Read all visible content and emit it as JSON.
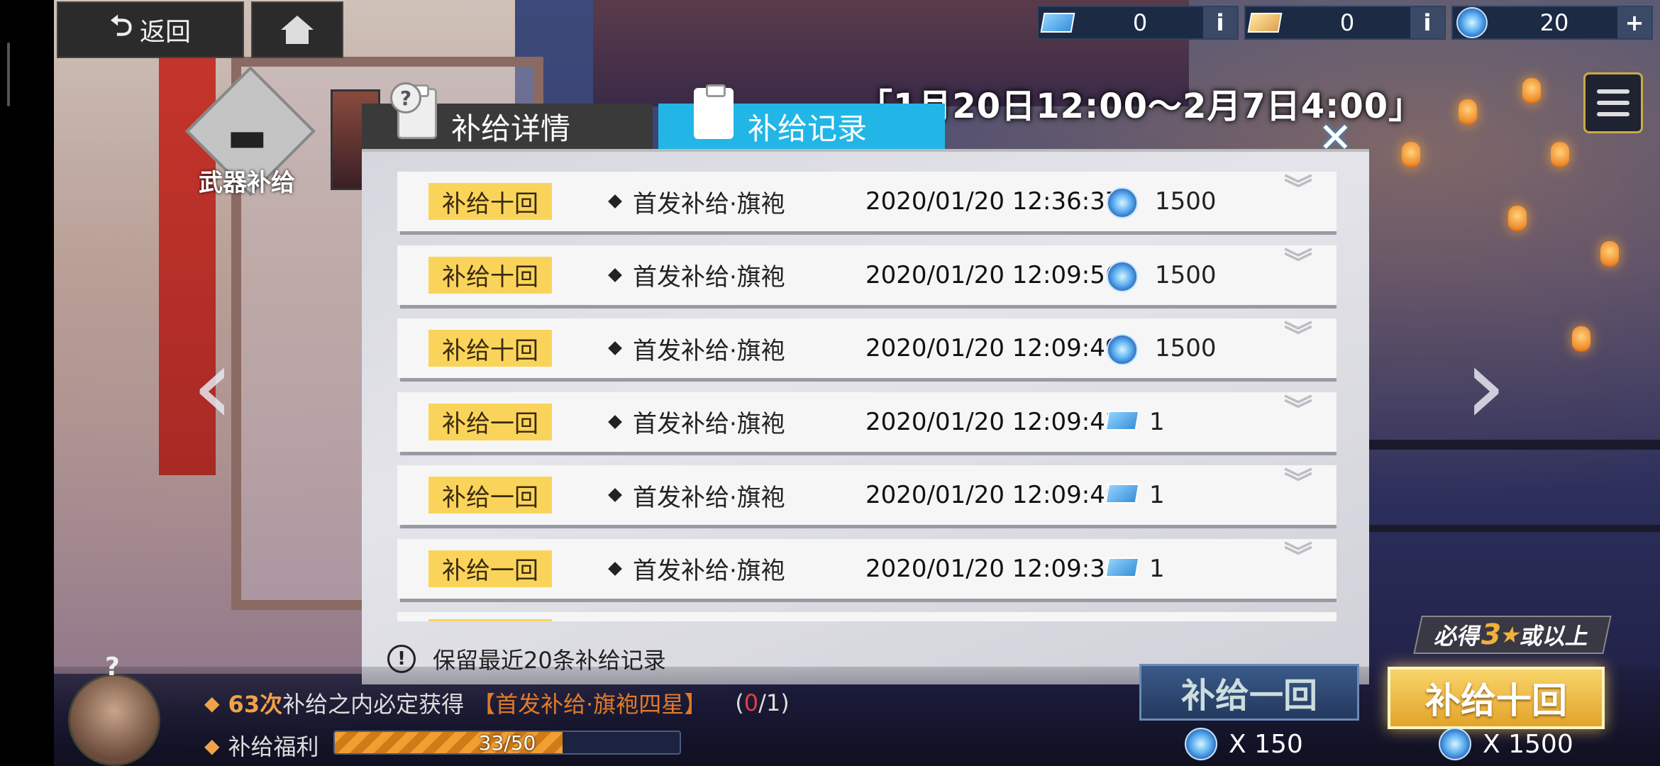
{
  "nav": {
    "back_label": "返回"
  },
  "currencies": [
    {
      "icon": "blue-ticket-icon",
      "value": "0",
      "action": "i"
    },
    {
      "icon": "gold-ticket-icon",
      "value": "0",
      "action": "i"
    },
    {
      "icon": "crystal-gem-icon",
      "value": "20",
      "action": "+"
    }
  ],
  "event": {
    "date_range": "「1月20日12:00～2月7日4:00」",
    "weapon_label": "武器补给"
  },
  "dialog": {
    "tab_details": "补给详情",
    "tab_records": "补给记录",
    "close": "✕",
    "notice": "保留最近20条补给记录",
    "records": [
      {
        "type": "补给十回",
        "item": "首发补给·旗袍",
        "time": "2020/01/20 12:36:37",
        "reward_icon": "crystal-gem-icon",
        "reward": "1500"
      },
      {
        "type": "补给十回",
        "item": "首发补给·旗袍",
        "time": "2020/01/20 12:09:56",
        "reward_icon": "crystal-gem-icon",
        "reward": "1500"
      },
      {
        "type": "补给十回",
        "item": "首发补给·旗袍",
        "time": "2020/01/20 12:09:49",
        "reward_icon": "crystal-gem-icon",
        "reward": "1500"
      },
      {
        "type": "补给一回",
        "item": "首发补给·旗袍",
        "time": "2020/01/20 12:09:43",
        "reward_icon": "blue-ticket-icon",
        "reward": "1"
      },
      {
        "type": "补给一回",
        "item": "首发补给·旗袍",
        "time": "2020/01/20 12:09:40",
        "reward_icon": "blue-ticket-icon",
        "reward": "1"
      },
      {
        "type": "补给一回",
        "item": "首发补给·旗袍",
        "time": "2020/01/20 12:09:36",
        "reward_icon": "blue-ticket-icon",
        "reward": "1"
      }
    ]
  },
  "bottom": {
    "help": "?",
    "guarantee_count": "63次",
    "guarantee_text": "补给之内必定获得",
    "guarantee_item": "【首发补给·旗袍四星】",
    "guarantee_progress_open": "(",
    "guarantee_progress_value": "0",
    "guarantee_progress_rest": "/1)",
    "welfare_label": "补给福利",
    "welfare_progress_text": "33/50",
    "welfare_progress": 0.66,
    "once_label": "补给一回",
    "once_cost": "X 150",
    "ten_label": "补给十回",
    "ten_cost": "X 1500",
    "guar_tag_prefix": "必得",
    "guar_tag_num": "3",
    "guar_tag_star": "★",
    "guar_tag_suffix": "或以上"
  },
  "colors": {
    "tab_active": "#22b6e6",
    "badge": "#fad45a",
    "accent_orange": "#f0a24a"
  }
}
